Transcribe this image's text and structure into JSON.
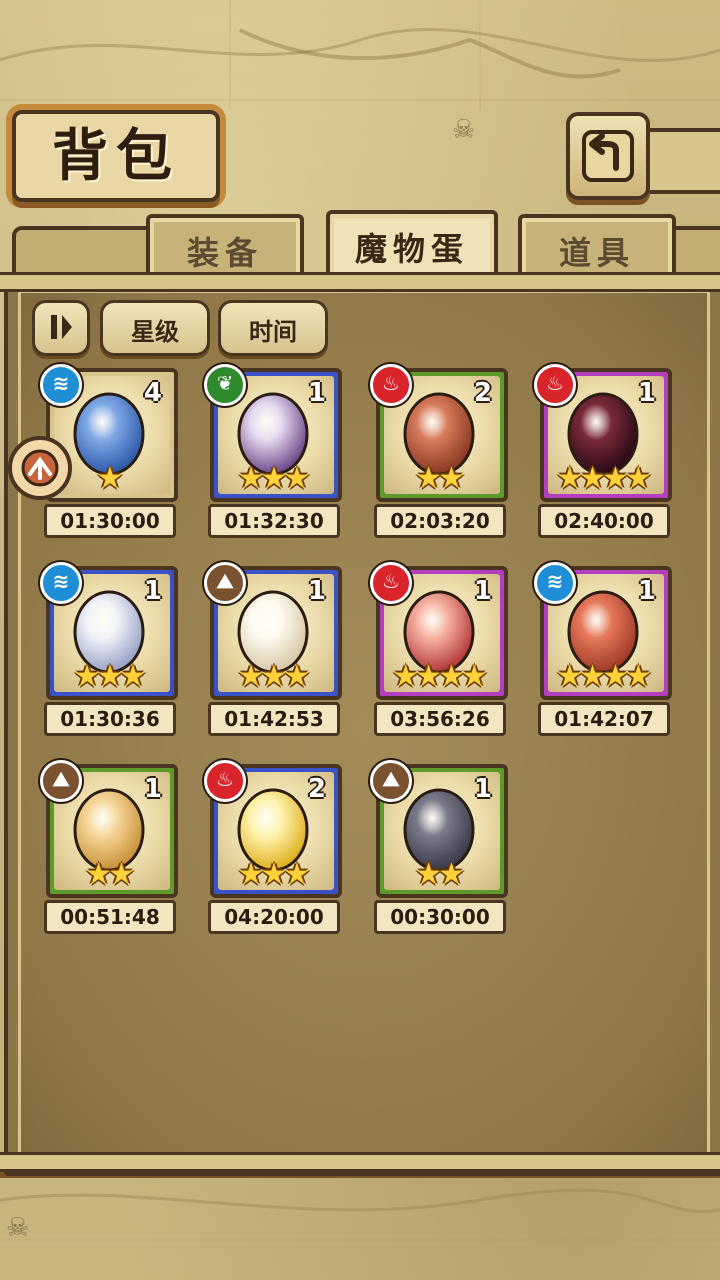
{
  "header": {
    "title": "背包"
  },
  "tabs": [
    {
      "label": "装备",
      "active": false
    },
    {
      "label": "魔物蛋",
      "active": true
    },
    {
      "label": "道具",
      "active": false
    }
  ],
  "sort_buttons": {
    "toggle_icon": "sort-order-icon",
    "star_label": "星级",
    "time_label": "时间"
  },
  "colors": {
    "fire": "#d8242a",
    "water": "#1e8fd6",
    "earth": "#7a5230",
    "leaf": "#2f8a2e",
    "rarity_green": "#5c9a2a",
    "rarity_blue": "#3a52c8",
    "rarity_purple": "#b33ec0",
    "rarity_gold": "#d6c48a"
  },
  "eggs": [
    {
      "element": "water",
      "count": "4",
      "stars": "★",
      "time": "01:30:00",
      "rarity": "gold"
    },
    {
      "element": "leaf",
      "count": "1",
      "stars": "★★★",
      "time": "01:32:30",
      "rarity": "blue"
    },
    {
      "element": "fire",
      "count": "2",
      "stars": "★★",
      "time": "02:03:20",
      "rarity": "green"
    },
    {
      "element": "fire",
      "count": "1",
      "stars": "★★★★",
      "time": "02:40:00",
      "rarity": "purple"
    },
    {
      "element": "water",
      "count": "1",
      "stars": "★★★",
      "time": "01:30:36",
      "rarity": "blue"
    },
    {
      "element": "earth",
      "count": "1",
      "stars": "★★★",
      "time": "01:42:53",
      "rarity": "blue"
    },
    {
      "element": "fire",
      "count": "1",
      "stars": "★★★★",
      "time": "03:56:26",
      "rarity": "purple"
    },
    {
      "element": "water",
      "count": "1",
      "stars": "★★★★",
      "time": "01:42:07",
      "rarity": "purple"
    },
    {
      "element": "earth",
      "count": "1",
      "stars": "★★",
      "time": "00:51:48",
      "rarity": "green"
    },
    {
      "element": "fire",
      "count": "2",
      "stars": "★★★",
      "time": "04:20:00",
      "rarity": "blue"
    },
    {
      "element": "earth",
      "count": "1",
      "stars": "★★",
      "time": "00:30:00",
      "rarity": "green"
    }
  ]
}
